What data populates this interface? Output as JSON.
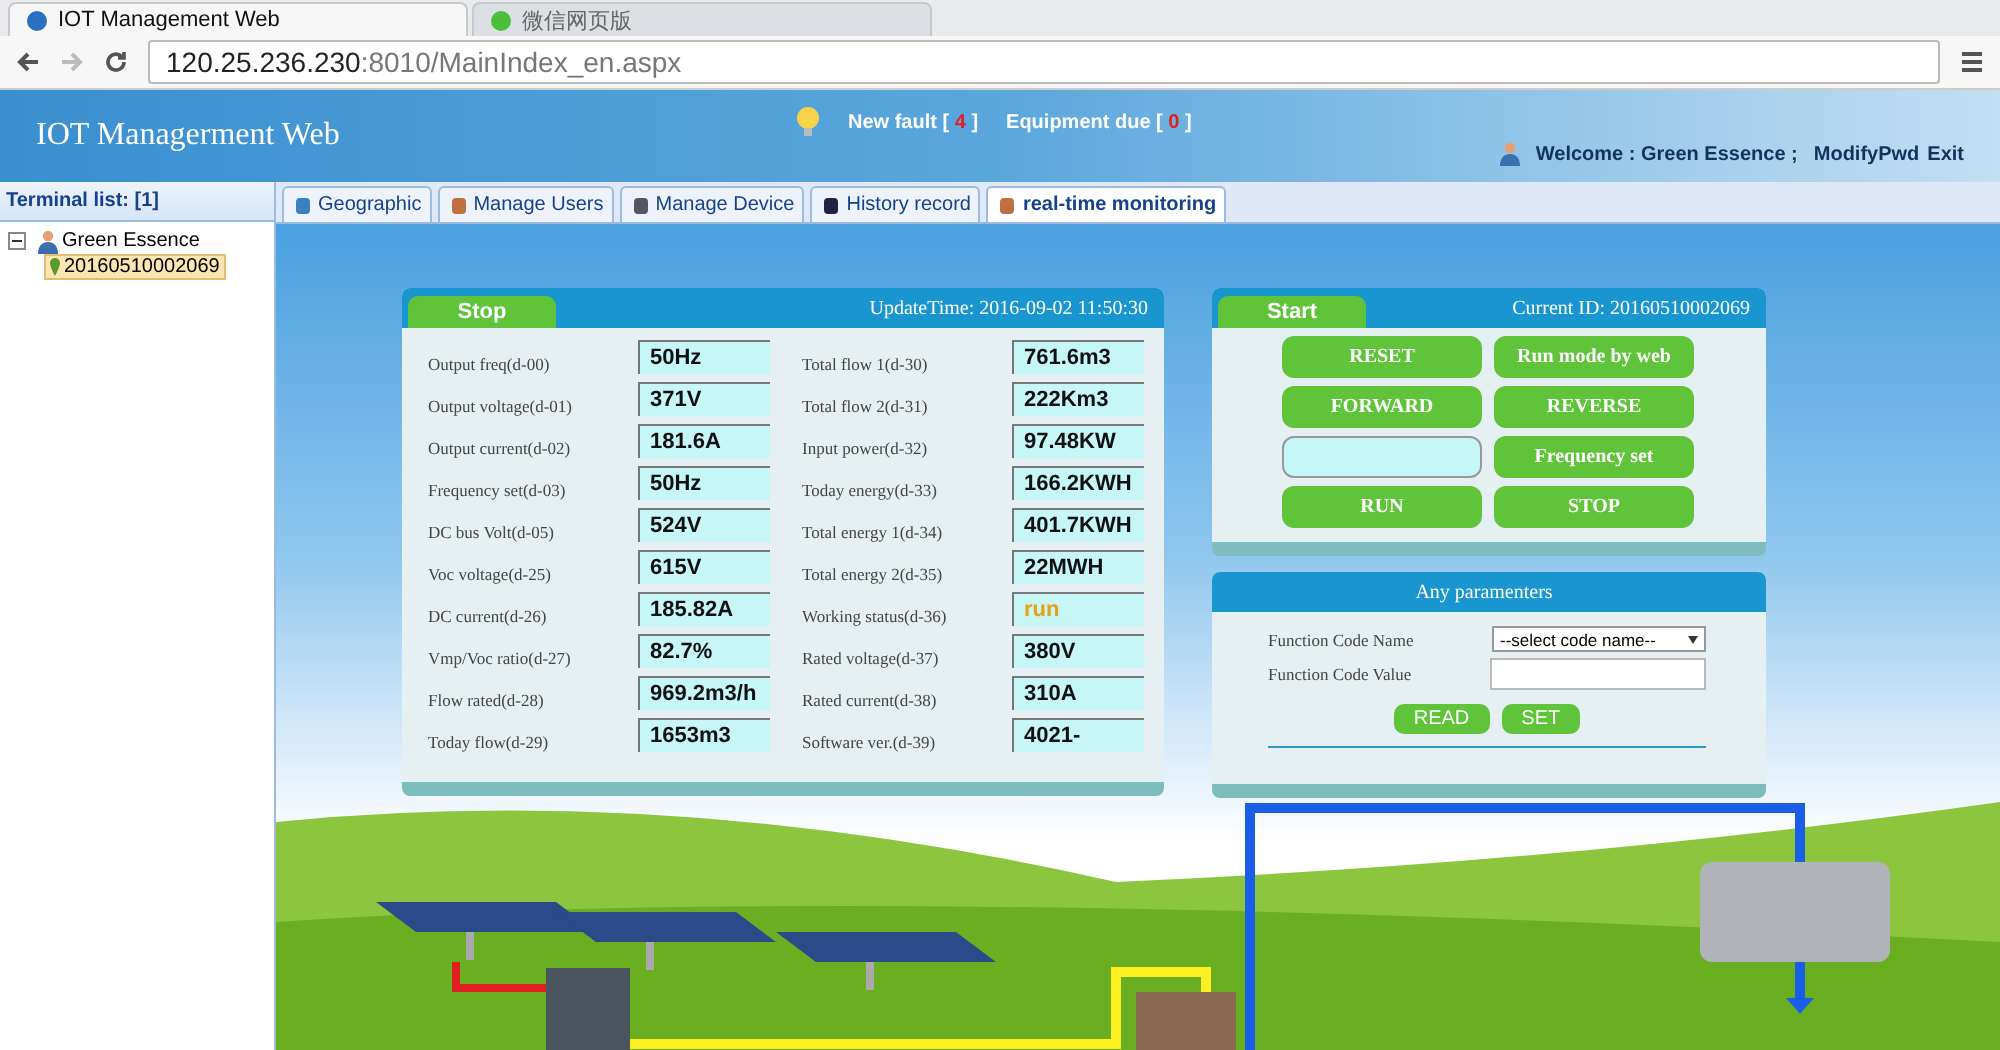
{
  "browser": {
    "tabs": [
      {
        "title": "IOT Management Web",
        "selected": true
      },
      {
        "title": "微信网页版",
        "selected": false
      }
    ],
    "url_host": "120.25.236.230",
    "url_rest": ":8010/MainIndex_en.aspx"
  },
  "header": {
    "title": "IOT Managerment Web",
    "notices": [
      {
        "label": "New fault [",
        "count": "4",
        "end": "]"
      },
      {
        "label": "Equipment due [",
        "count": "0",
        "end": "]"
      }
    ],
    "welcome": "Welcome : Green Essence ;",
    "links": [
      "ModifyPwd",
      "Exit"
    ]
  },
  "sidebar": {
    "title": "Terminal list: [1]",
    "tree": [
      {
        "label": "Green Essence",
        "expanded": true,
        "children": [
          {
            "label": "20160510002069",
            "selected": true
          }
        ]
      }
    ]
  },
  "tabs": [
    {
      "label": "Geographic",
      "selected": false
    },
    {
      "label": "Manage Users",
      "selected": false
    },
    {
      "label": "Manage Device",
      "selected": false
    },
    {
      "label": "History record",
      "selected": false
    },
    {
      "label": "real-time monitoring",
      "selected": true
    }
  ],
  "status_panel": {
    "state": "Stop",
    "update_time": "UpdateTime: 2016-09-02 11:50:30",
    "left": [
      {
        "label": "Output freq(d-00)",
        "value": "50Hz",
        "kind": "reading"
      },
      {
        "label": "Output voltage(d-01)",
        "value": "371V",
        "kind": "reading"
      },
      {
        "label": "Output current(d-02)",
        "value": "181.6A",
        "kind": "reading"
      },
      {
        "label": "Frequency set(d-03)",
        "value": "50Hz",
        "kind": "reading"
      },
      {
        "label": "DC bus Volt(d-05)",
        "value": "524V",
        "kind": "reading"
      },
      {
        "label": "Voc voltage(d-25)",
        "value": "615V",
        "kind": "reading"
      },
      {
        "label": "DC current(d-26)",
        "value": "185.82A",
        "kind": "reading"
      },
      {
        "label": "Vmp/Voc ratio(d-27)",
        "value": "82.7%",
        "kind": "reading"
      },
      {
        "label": "Flow rated(d-28)",
        "value": "969.2m3/h",
        "kind": "reading"
      },
      {
        "label": "Today flow(d-29)",
        "value": "1653m3",
        "kind": "reading"
      }
    ],
    "right": [
      {
        "label": "Total flow 1(d-30)",
        "value": "761.6m3",
        "kind": "reading"
      },
      {
        "label": "Total flow 2(d-31)",
        "value": "222Km3",
        "kind": "reading"
      },
      {
        "label": "Input power(d-32)",
        "value": "97.48KW",
        "kind": "reading"
      },
      {
        "label": "Today energy(d-33)",
        "value": "166.2KWH",
        "kind": "reading"
      },
      {
        "label": "Total energy 1(d-34)",
        "value": "401.7KWH",
        "kind": "reading"
      },
      {
        "label": "Total energy 2(d-35)",
        "value": "22MWH",
        "kind": "reading"
      },
      {
        "label": "Working status(d-36)",
        "value": "run",
        "kind": "status"
      },
      {
        "label": "Rated voltage(d-37)",
        "value": "380V",
        "kind": "reading"
      },
      {
        "label": "Rated current(d-38)",
        "value": "310A",
        "kind": "reading"
      },
      {
        "label": "Software ver.(d-39)",
        "value": "4021-",
        "kind": "reading"
      }
    ]
  },
  "control_panel": {
    "state": "Start",
    "current_id": "Current ID: 20160510002069",
    "controls": [
      {
        "kind": "button",
        "label": "RESET"
      },
      {
        "kind": "button",
        "label": "Run mode by web"
      },
      {
        "kind": "button",
        "label": "FORWARD"
      },
      {
        "kind": "button",
        "label": "REVERSE"
      },
      {
        "kind": "input"
      },
      {
        "kind": "button",
        "label": "Frequency set"
      },
      {
        "kind": "button",
        "label": "RUN"
      },
      {
        "kind": "button",
        "label": "STOP"
      }
    ]
  },
  "params_panel": {
    "title": "Any paramenters",
    "name_label": "Function Code Name",
    "select_value": "--select code name--",
    "value_label": "Function Code Value",
    "buttons": [
      "READ",
      "SET"
    ]
  }
}
